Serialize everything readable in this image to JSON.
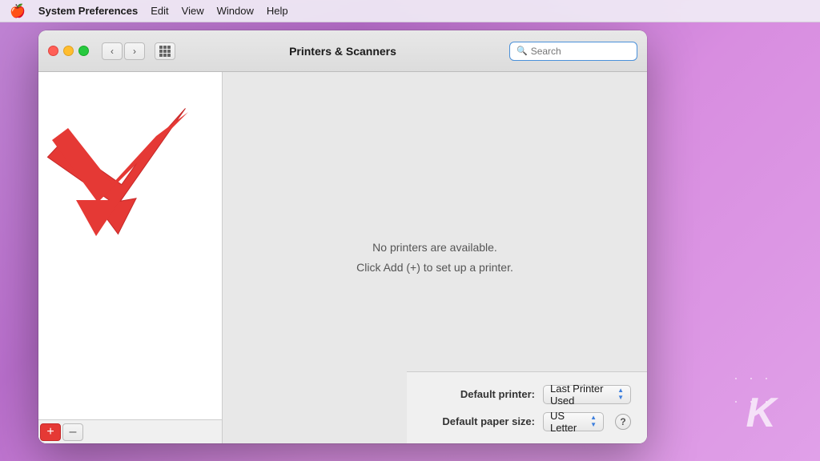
{
  "menubar": {
    "apple": "🍎",
    "app_name": "System Preferences",
    "items": [
      "Edit",
      "View",
      "Window",
      "Help"
    ]
  },
  "titlebar": {
    "title": "Printers & Scanners",
    "search_placeholder": "Search"
  },
  "nav": {
    "back": "‹",
    "forward": "›"
  },
  "printer_list": {
    "add_label": "+",
    "remove_label": "–"
  },
  "detail": {
    "line1": "No printers are available.",
    "line2": "Click Add (+) to set up a printer."
  },
  "bottom": {
    "default_printer_label": "Default printer:",
    "default_printer_value": "Last Printer Used",
    "default_paper_label": "Default paper size:",
    "default_paper_value": "US Letter",
    "help_label": "?"
  },
  "icons": {
    "chevron_up": "▲",
    "chevron_down": "▼",
    "search": "🔍"
  }
}
